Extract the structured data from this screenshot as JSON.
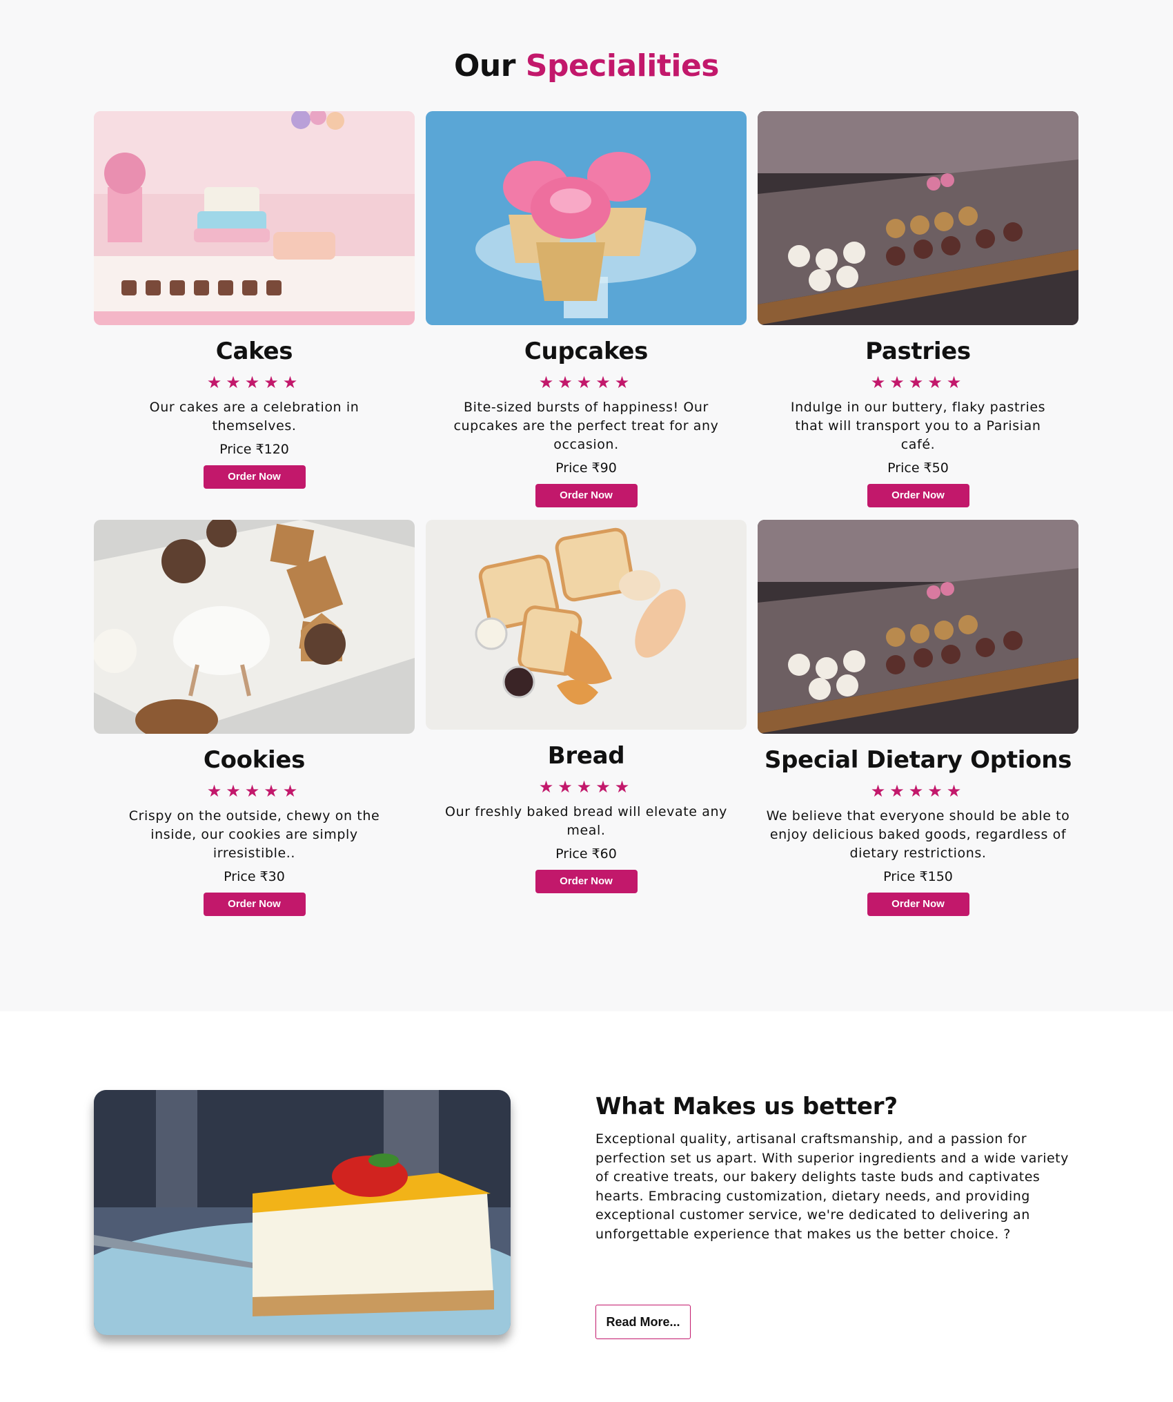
{
  "heading": {
    "prefix": "Our",
    "accent": "Specialities"
  },
  "accent_color": "#c2186b",
  "products": [
    {
      "name": "Cakes",
      "rating": "★★★★★",
      "description": "Our cakes are a celebration in themselves.",
      "price": "Price ₹120",
      "button": "Order Now",
      "image": "cakes-table-image"
    },
    {
      "name": "Cupcakes",
      "rating": "★★★★★",
      "description": "Bite-sized bursts of happiness! Our cupcakes are the perfect treat for any occasion.",
      "price": "Price ₹90",
      "button": "Order Now",
      "image": "cupcakes-image"
    },
    {
      "name": "Pastries",
      "rating": "★★★★★",
      "description": "Indulge in our buttery, flaky pastries that will transport you to a Parisian café.",
      "price": "Price ₹50",
      "button": "Order Now",
      "image": "pastry-display-image"
    },
    {
      "name": "Cookies",
      "rating": "★★★★★",
      "description": "Crispy on the outside, chewy on the inside, our cookies are simply irresistible..",
      "price": "Price ₹30",
      "button": "Order Now",
      "image": "cookies-image"
    },
    {
      "name": "Bread",
      "rating": "★★★★★",
      "description": "Our freshly baked bread will elevate any meal.",
      "price": "Price ₹60",
      "button": "Order Now",
      "image": "bread-image"
    },
    {
      "name": "Special Dietary Options",
      "rating": "★★★★★",
      "description": "We believe that everyone should be able to enjoy delicious baked goods, regardless of dietary restrictions.",
      "price": "Price ₹150",
      "button": "Order Now",
      "image": "pastry-display-image"
    }
  ],
  "better": {
    "title": "What Makes us better?",
    "description": "Exceptional quality, artisanal craftsmanship, and a passion for perfection set us apart. With superior ingredients and a wide variety of creative treats, our bakery delights taste buds and captivates hearts. Embracing customization, dietary needs, and providing exceptional customer service, we're dedicated to delivering an unforgettable experience that makes us the better choice. ?",
    "button": "Read More...",
    "image": "cheesecake-image"
  }
}
